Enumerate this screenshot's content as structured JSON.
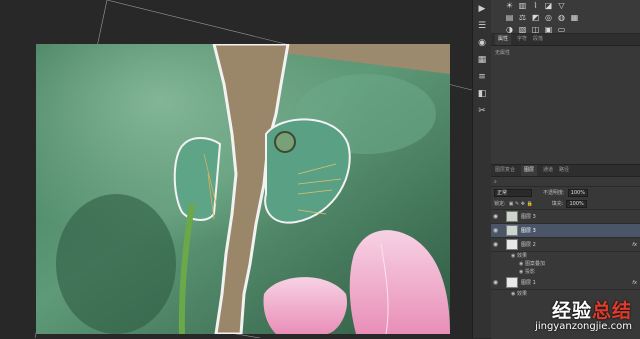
{
  "canvas": {
    "bg": "#282828"
  },
  "toolstrip": {
    "icons": [
      "play-icon",
      "menu-icon",
      "palette-icon",
      "swatch-icon",
      "layers-icon",
      "channels-icon",
      "tools-icon"
    ]
  },
  "properties": {
    "tabs": [
      "属性",
      "字符",
      "段落"
    ],
    "empty_text": "无属性"
  },
  "layers_panel": {
    "tabs": [
      "图层复合",
      "图层",
      "通道",
      "路径"
    ],
    "blend_mode": "正常",
    "opacity_label": "不透明度:",
    "opacity_value": "100%",
    "lock_label": "锁定:",
    "fill_label": "填充:",
    "fill_value": "100%",
    "layers": [
      {
        "name": "图层 3",
        "selected": false,
        "fx": ""
      },
      {
        "name": "图层 3",
        "selected": true,
        "fx": ""
      },
      {
        "name": "图层 2",
        "selected": false,
        "fx": "fx"
      },
      {
        "name": "效果",
        "sub": true
      },
      {
        "name": "图案叠加",
        "sub": true,
        "deep": true
      },
      {
        "name": "投影",
        "sub": true,
        "deep": true
      },
      {
        "name": "图层 1",
        "selected": false,
        "fx": "fx"
      },
      {
        "name": "效果",
        "sub": true
      }
    ]
  },
  "watermark": {
    "cn_white": "经验",
    "cn_red": "总结",
    "url": "jingyanzongjie.com"
  }
}
